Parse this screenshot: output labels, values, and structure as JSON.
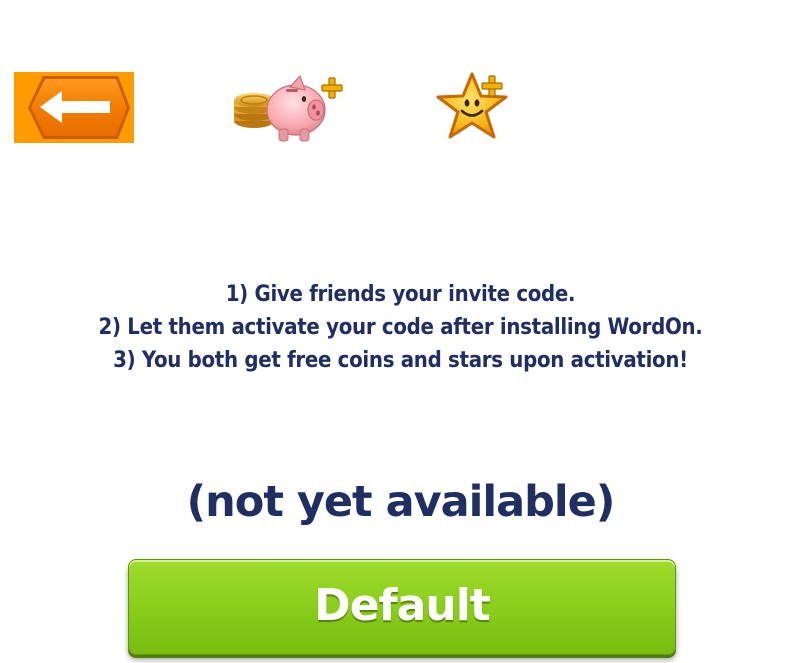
{
  "toolbar": {
    "back_icon": "left-arrow-icon",
    "coins_icon": "piggy-bank-coins-plus-icon",
    "stars_icon": "star-plus-icon"
  },
  "instructions": {
    "lines": [
      "1) Give friends your invite code.",
      "2) Let them activate your code after installing WordOn.",
      "3) You both get free coins and stars upon activation!"
    ]
  },
  "invite": {
    "status": "(not yet available)",
    "button_label": "Default"
  },
  "colors": {
    "text": "#1f2f63",
    "back_button": "#f07a00",
    "default_button": "#8ccf1c"
  }
}
